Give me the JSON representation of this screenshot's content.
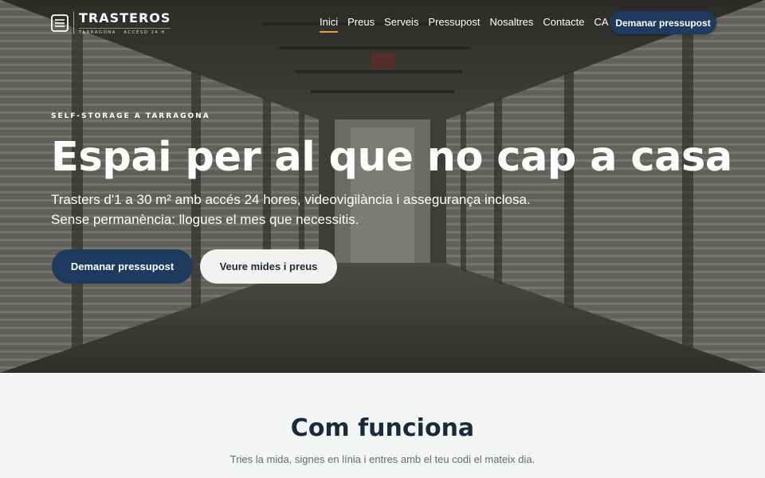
{
  "header": {
    "logo_name": "TRASTEROS",
    "logo_tagline": "TARRAGONA · ACCESO 24 H",
    "nav": [
      "Inici",
      "Preus",
      "Serveis",
      "Pressupost",
      "Nosaltres",
      "Contacte"
    ],
    "active_nav": "Inici",
    "language": "CA",
    "cta_label": "Demanar pressupost"
  },
  "hero": {
    "eyebrow": "SELF-STORAGE A TARRAGONA",
    "headline": "Espai per al que no cap a casa",
    "sub_line1": "Trasters d'1 a 30 m² amb accés 24 hores, videovigilància i assegurança inclosa.",
    "sub_line2": "Sense permanència: llogues el mes que necessitis.",
    "primary_button": "Demanar pressupost",
    "secondary_button": "Veure mides i preus"
  },
  "section": {
    "title": "Com funciona",
    "subtitle": "Tries la mida, signes en línia i entres amb el teu codi el mateix dia."
  },
  "colors": {
    "navy": "#1f3a5f",
    "accent": "#e3a72f",
    "section_bg": "#f4f5f5"
  }
}
